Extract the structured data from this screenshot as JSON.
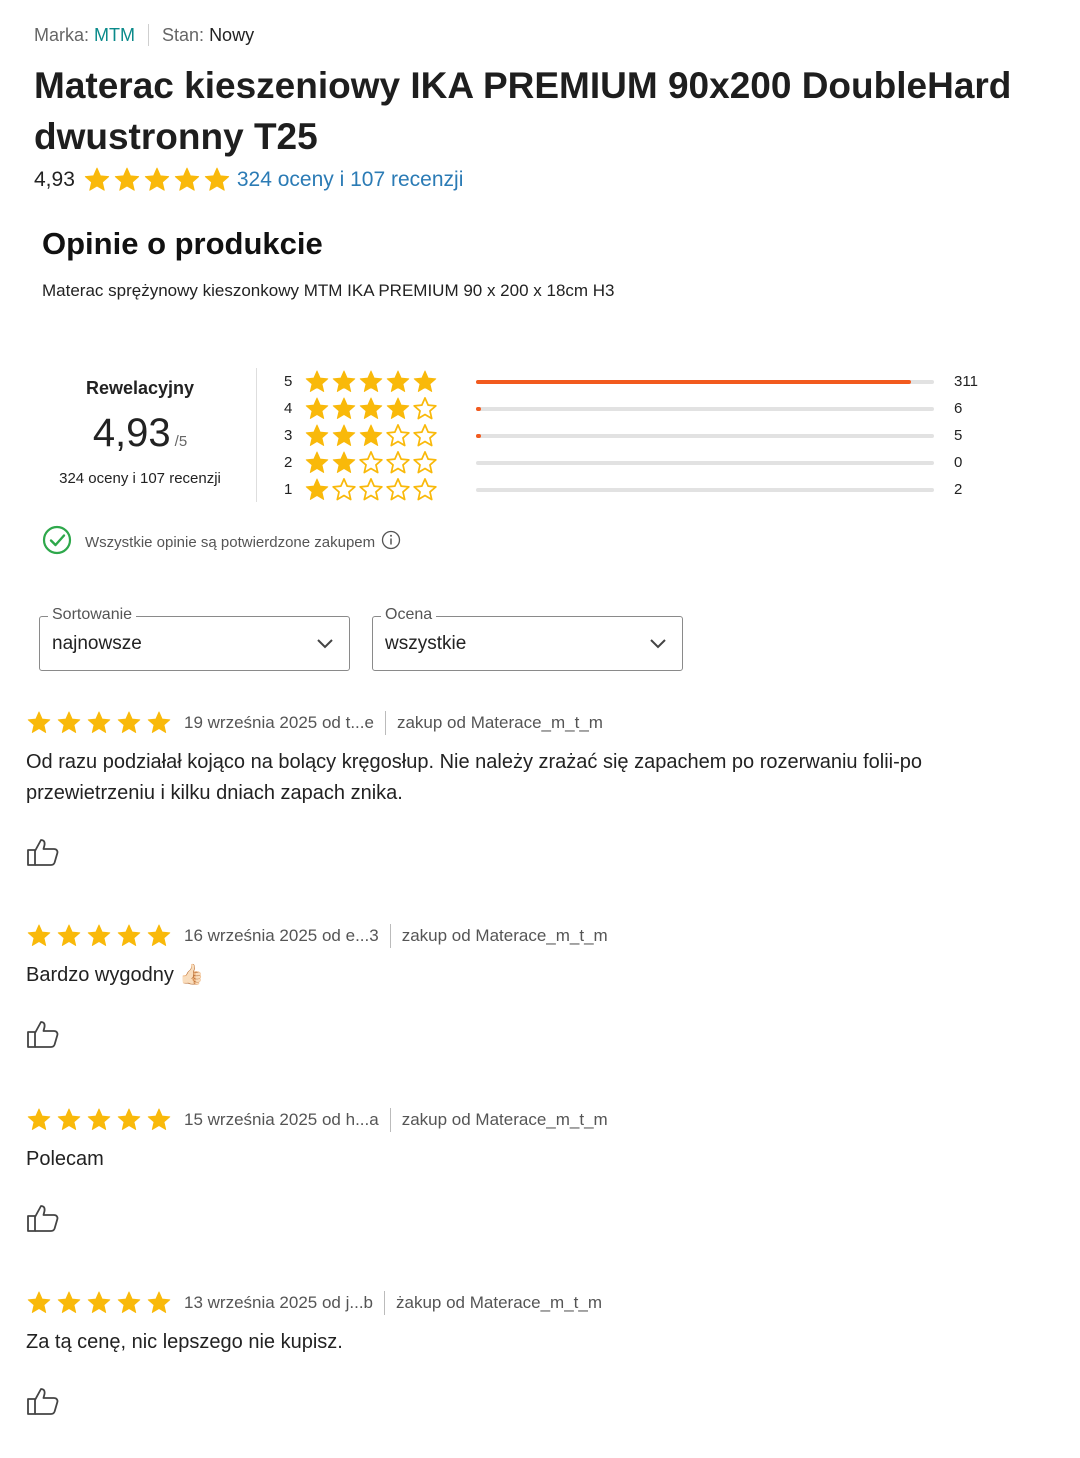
{
  "meta": {
    "brand_label": "Marka:",
    "brand_value": "MTM",
    "condition_label": "Stan:",
    "condition_value": "Nowy"
  },
  "product": {
    "title": "Materac kieszeniowy IKA PREMIUM 90x200 DoubleHard dwustronny T25",
    "rating": "4,93",
    "rating_stars": 5,
    "reviews_link": "324 oceny i 107 recenzji"
  },
  "opinions": {
    "title": "Opinie o produkcie",
    "subtitle": "Materac sprężynowy kieszonkowy MTM IKA PREMIUM 90 x 200 x 18cm H3",
    "summary": {
      "label": "Rewelacyjny",
      "score": "4,93",
      "out_of": "/5",
      "count_text": "324 oceny i 107 recenzji"
    },
    "distribution": [
      {
        "stars": "5",
        "filled": 5,
        "count": "311",
        "fraction": 0.949
      },
      {
        "stars": "4",
        "filled": 4,
        "count": "6",
        "fraction": 0.01
      },
      {
        "stars": "3",
        "filled": 3,
        "count": "5",
        "fraction": 0.01
      },
      {
        "stars": "2",
        "filled": 2,
        "count": "0",
        "fraction": 0.0
      },
      {
        "stars": "1",
        "filled": 1,
        "count": "2",
        "fraction": 0.0
      }
    ],
    "verified_text": "Wszystkie opinie są potwierdzone zakupem"
  },
  "filters": {
    "sort_label": "Sortowanie",
    "sort_value": "najnowsze",
    "rating_label": "Ocena",
    "rating_value": "wszystkie"
  },
  "reviews": [
    {
      "stars": 5,
      "date": "19 września 2025 od t...e",
      "seller": "zakup od Materace_m_t_m",
      "text": "Od razu podziałał kojąco na bolący kręgosłup. Nie należy zrażać się zapachem po rozerwaniu folii-po przewietrzeniu i kilku dniach zapach znika."
    },
    {
      "stars": 5,
      "date": "16 września 2025 od e...3",
      "seller": "zakup od Materace_m_t_m",
      "text": "Bardzo wygodny 👍🏻"
    },
    {
      "stars": 5,
      "date": "15 września 2025 od h...a",
      "seller": "zakup od Materace_m_t_m",
      "text": "Polecam"
    },
    {
      "stars": 5,
      "date": "13 września 2025 od j...b",
      "seller": "żakup od Materace_m_t_m",
      "text": "Za tą cenę, nic lepszego nie kupisz."
    }
  ],
  "colors": {
    "star": "#f9b90a",
    "bar_fill": "#f25a1e",
    "link": "#2b7bb5",
    "brand": "#0a8a8a",
    "verified": "#2ea84b"
  },
  "icons": {
    "star": "star-icon",
    "star_empty": "star-outline-icon",
    "verified": "check-circle-icon",
    "info": "info-icon",
    "chevron": "chevron-down-icon",
    "like": "thumbs-up-icon"
  }
}
